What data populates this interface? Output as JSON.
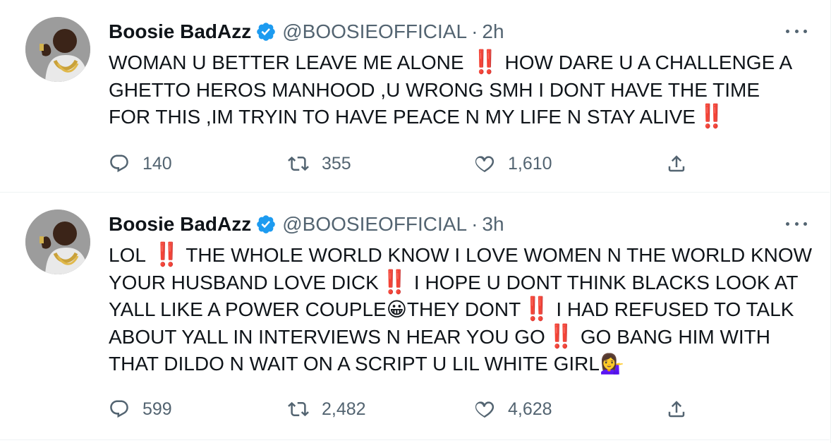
{
  "tweets": [
    {
      "author": {
        "name": "Boosie BadAzz",
        "handle": "@BOOSIEOFFICIAL",
        "verified": true
      },
      "separator": "·",
      "time": "2h",
      "text": {
        "p1": "WOMAN U BETTER LEAVE ME ALONE ",
        "e1": "‼️",
        "p2": " HOW DARE U A CHALLENGE A\nGHETTO HEROS MANHOOD ,U WRONG SMH I DONT HAVE THE TIME\nFOR THIS ,IM TRYIN TO HAVE PEACE N MY LIFE N STAY ALIVE",
        "e2": "‼️"
      },
      "actions": {
        "replies": "140",
        "retweets": "355",
        "likes": "1,610"
      }
    },
    {
      "author": {
        "name": "Boosie BadAzz",
        "handle": "@BOOSIEOFFICIAL",
        "verified": true
      },
      "separator": "·",
      "time": "3h",
      "text": {
        "p1": "LOL ",
        "e1": "‼️",
        "p2": " THE WHOLE WORLD KNOW I LOVE WOMEN N THE WORLD KNOW\nYOUR HUSBAND LOVE DICK",
        "e2": "‼️",
        "p3": " I HOPE U DONT THINK BLACKS LOOK AT\nYALL LIKE A POWER COUPLE",
        "e3": "😀",
        "p4": "THEY DONT",
        "e4": "‼️",
        "p5": " I HAD REFUSED TO TALK\nABOUT YALL IN INTERVIEWS N HEAR YOU GO",
        "e5": "‼️",
        "p6": " GO BANG HIM WITH\nTHAT DILDO N WAIT ON A SCRIPT U LIL WHITE GIRL",
        "e6": "💁‍♀️"
      },
      "actions": {
        "replies": "599",
        "retweets": "2,482",
        "likes": "4,628"
      }
    }
  ],
  "icons": {
    "verified": "verified-badge-icon",
    "more": "more-icon",
    "reply": "reply-icon",
    "retweet": "retweet-icon",
    "like": "like-icon",
    "share": "share-icon"
  },
  "colors": {
    "text": "#0f1419",
    "secondary": "#536471",
    "verified": "#1d9bf0",
    "border": "#eff3f4",
    "double_exclamation": "#c0122a"
  }
}
